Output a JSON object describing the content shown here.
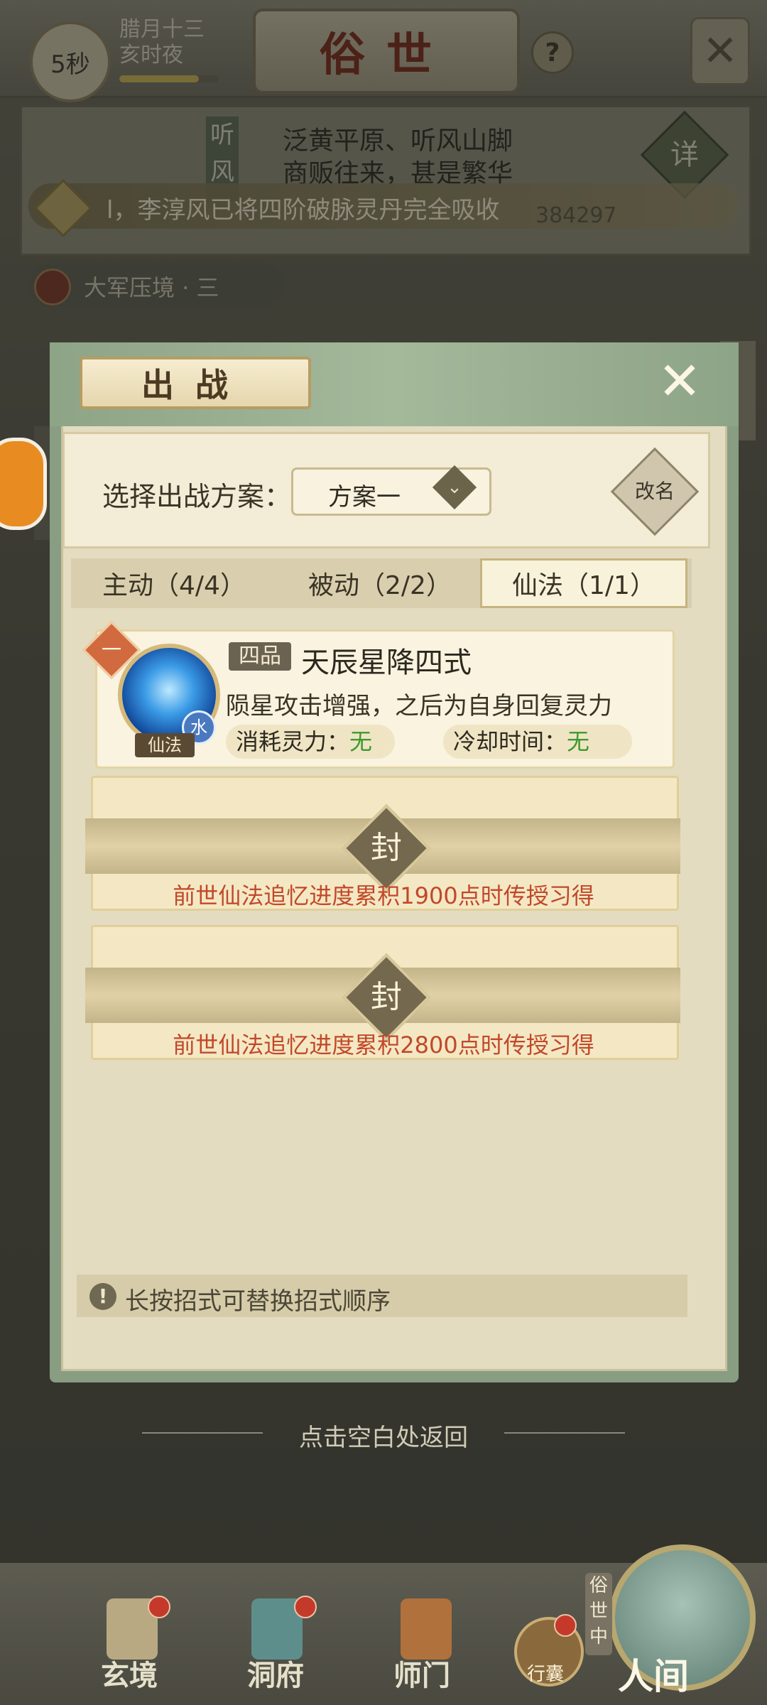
{
  "header": {
    "timer": "5秒",
    "lunar_date": "腊月十三",
    "lunar_time": "亥时夜",
    "lunar_progress": 0.8,
    "title": "俗世",
    "help": "?",
    "close": "✕"
  },
  "location": {
    "vertical_label": "听风",
    "description_line1": "泛黄平原、听风山脚",
    "description_line2": "商贩往来，甚是繁华",
    "detail_button": "详",
    "ticker": "l，李淳风已将四阶破脉灵丹完全吸收",
    "ticker_number": "384297"
  },
  "mission": {
    "label": "大军压境 · 三"
  },
  "modal": {
    "title": "出战",
    "close": "✕",
    "scheme_label": "选择出战方案：",
    "scheme_value": "方案一",
    "scheme_arrow": "⌄",
    "rename": "改名",
    "tabs": [
      {
        "label": "主动（4/4）"
      },
      {
        "label": "被动（2/2）"
      },
      {
        "label": "仙法（1/1）"
      }
    ],
    "skill": {
      "rank": "一",
      "grade": "四品",
      "name": "天辰星降四式",
      "element": "水",
      "type": "仙法",
      "description": "陨星攻击增强，之后为自身回复灵力",
      "cost_label": "消耗灵力：",
      "cost_value": "无",
      "cooldown_label": "冷却时间：",
      "cooldown_value": "无"
    },
    "locked_slots": [
      {
        "seal": "封",
        "text": "前世仙法追忆进度累积1900点时传授习得"
      },
      {
        "seal": "封",
        "text": "前世仙法追忆进度累积2800点时传授习得"
      }
    ],
    "tip_icon": "!",
    "tip": "长按招式可替换招式顺序"
  },
  "back_hint": "点击空白处返回",
  "bottom_nav": {
    "items": [
      {
        "label": "玄境"
      },
      {
        "label": "洞府"
      },
      {
        "label": "师门"
      }
    ],
    "bag_label": "行囊",
    "world_tag": "俗世中",
    "world_label": "人间"
  },
  "colors": {
    "accent_green": "#3e9a2e",
    "unlock_red": "#c2482a",
    "modal_border": "#889d81"
  }
}
